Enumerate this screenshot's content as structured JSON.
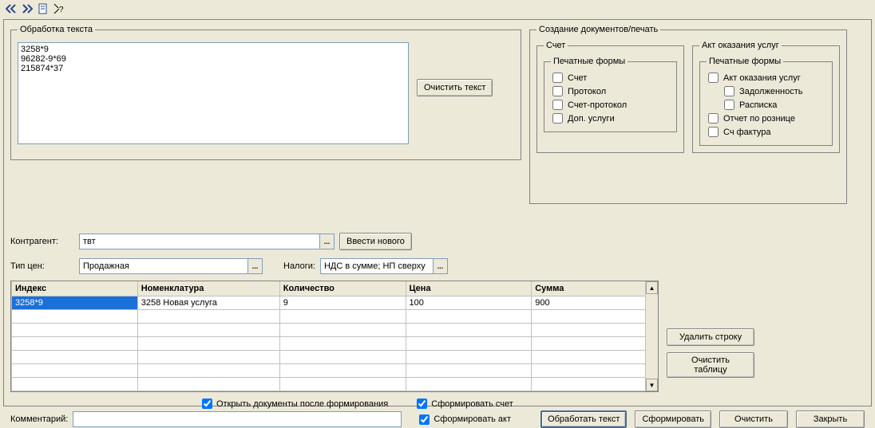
{
  "toolbar_icons": [
    "rewind-icon",
    "fastforward-icon",
    "doc-icon",
    "help-icon"
  ],
  "text_processing": {
    "legend": "Обработка текста",
    "text": "3258*9\n96282-9*69\n215874*37",
    "clear_btn": "Очистить текст"
  },
  "docs": {
    "legend": "Создание документов/печать",
    "invoice": {
      "legend": "Счет",
      "print_legend": "Печатные формы",
      "items": [
        {
          "label": "Счет",
          "checked": false
        },
        {
          "label": "Протокол",
          "checked": false
        },
        {
          "label": "Счет-протокол",
          "checked": false
        },
        {
          "label": "Доп. услуги",
          "checked": false
        }
      ]
    },
    "act": {
      "legend": "Акт оказания услуг",
      "print_legend": "Печатные формы",
      "items": [
        {
          "label": "Акт оказания услуг",
          "checked": false,
          "indent": false
        },
        {
          "label": "Задолженность",
          "checked": false,
          "indent": true
        },
        {
          "label": "Расписка",
          "checked": false,
          "indent": true
        },
        {
          "label": "Отчет по рознице",
          "checked": false,
          "indent": false
        },
        {
          "label": "Сч фактура",
          "checked": false,
          "indent": false
        }
      ]
    }
  },
  "contragent": {
    "label": "Контрагент:",
    "value": "твт",
    "new_btn": "Ввести нового"
  },
  "price_type": {
    "label": "Тип цен:",
    "value": "Продажная"
  },
  "taxes": {
    "label": "Налоги:",
    "value": "НДС в сумме; НП сверху"
  },
  "grid": {
    "columns": [
      "Индекс",
      "Номенклатура",
      "Количество",
      "Цена",
      "Сумма"
    ],
    "rows": [
      {
        "cells": [
          "3258*9",
          "3258 Новая услуга",
          "9",
          "100",
          "900"
        ],
        "selected": true
      }
    ],
    "empty_rows": 6
  },
  "side": {
    "del_row": "Удалить строку",
    "clear_tbl": "Очистить таблицу"
  },
  "bottom": {
    "open_after": {
      "label": "Открыть документы после формирования",
      "checked": true
    },
    "form_invoice": {
      "label": "Сформировать счет",
      "checked": true
    },
    "form_act": {
      "label": "Сформировать акт",
      "checked": true
    },
    "comment_label": "Комментарий:",
    "comment_value": "",
    "process": "Обработать текст",
    "form": "Сформировать",
    "clear": "Очистить",
    "close": "Закрыть"
  }
}
